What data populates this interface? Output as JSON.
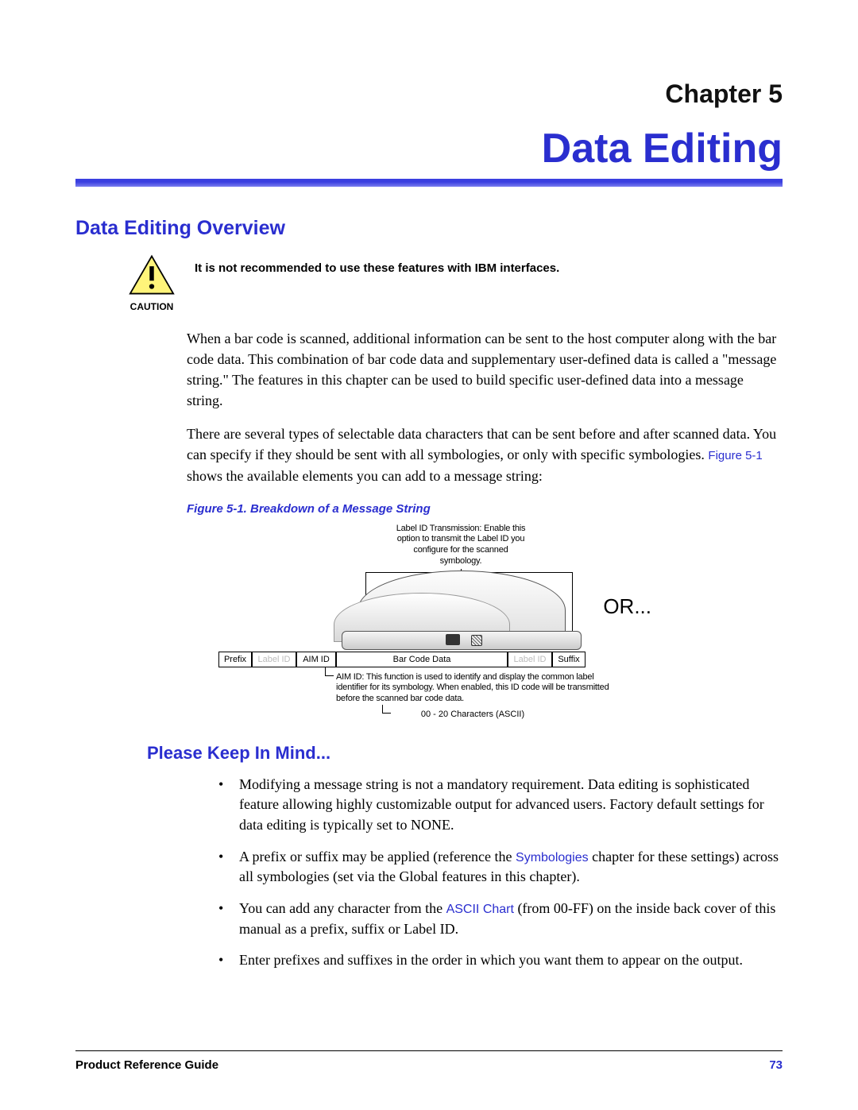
{
  "chapter": {
    "prefix": "Chapter 5",
    "title": "Data Editing"
  },
  "section1": {
    "heading": "Data Editing Overview",
    "caution": {
      "label": "CAUTION",
      "text": "It is not recommended to use these features with IBM interfaces."
    },
    "para1": "When a bar code is scanned, additional information can be sent to the host computer along with the bar code data. This combination of bar code data and supplementary user-defined data is called a \"message string.\" The features in this chapter can be used to build specific user-defined data into a message string.",
    "para2_a": "There are several types of selectable data characters that can be sent before and after scanned data. You can specify if they should be sent with all symbologies, or only with specific symbologies. ",
    "para2_ref": "Figure 5-1",
    "para2_b": " shows the available elements you can add to a message string:"
  },
  "figure": {
    "caption": "Figure 5-1. Breakdown of a Message String",
    "labelid_note": "Label ID Transmission: Enable this option to transmit the Label ID you configure for the scanned symbology.",
    "or_label": "OR...",
    "cells": {
      "prefix": "Prefix",
      "labelid1": "Label ID",
      "aimid": "AIM ID",
      "barcode": "Bar Code Data",
      "labelid2": "Label ID",
      "suffix": "Suffix"
    },
    "aimid_note": "AIM ID: This function is used to identify and display the common label identifier for its symbology. When enabled, this ID code will be transmitted before the scanned bar code data.",
    "ascii_note": "00 - 20 Characters (ASCII)"
  },
  "section2": {
    "heading": "Please Keep In Mind...",
    "bullets": [
      {
        "pre": "Modifying a message string is not a mandatory requirement. Data editing is sophisticated feature allowing highly customizable output for advanced users. Factory default settings for data editing is typically set to NONE."
      },
      {
        "pre": "A prefix or suffix may be applied (reference the ",
        "xref": "Symbologies",
        "post": " chapter for these settings) across all symbologies (set via the Global features in this chapter)."
      },
      {
        "pre": "You can add any character from the ",
        "xref": "ASCII Chart",
        "post": " (from 00-FF) on the inside back cover of this manual as a prefix, suffix or Label ID."
      },
      {
        "pre": "Enter prefixes and suffixes in the order in which you want them to appear on the output."
      }
    ]
  },
  "footer": {
    "left": "Product Reference Guide",
    "page": "73"
  }
}
